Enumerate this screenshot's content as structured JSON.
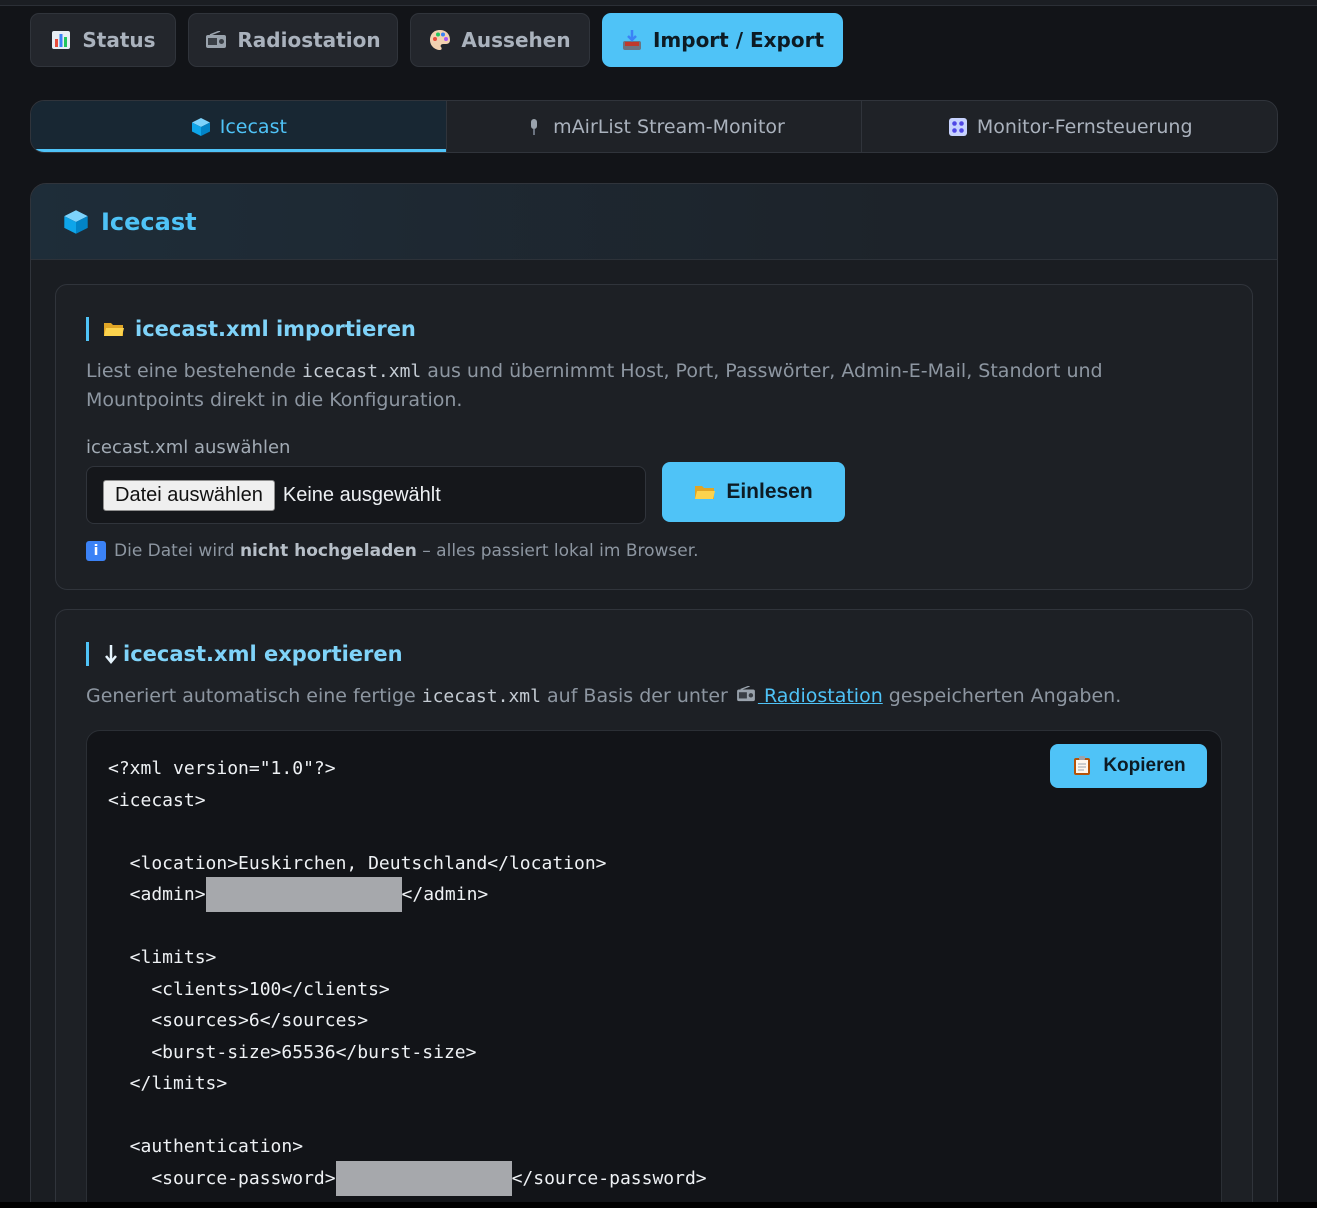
{
  "main_tabs": [
    {
      "label": "Status",
      "icon": "bar-chart-icon",
      "active": false
    },
    {
      "label": "Radiostation",
      "icon": "radio-icon",
      "active": false
    },
    {
      "label": "Aussehen",
      "icon": "palette-icon",
      "active": false
    },
    {
      "label": "Import / Export",
      "icon": "inbox-tray-icon",
      "active": true
    }
  ],
  "sub_tabs": [
    {
      "label": "Icecast",
      "icon": "cube-icon",
      "active": true
    },
    {
      "label": "mAirList Stream-Monitor",
      "icon": "microphone-icon",
      "active": false
    },
    {
      "label": "Monitor-Fernsteuerung",
      "icon": "control-knobs-icon",
      "active": false
    }
  ],
  "panel": {
    "title": "Icecast"
  },
  "import": {
    "title": "icecast.xml importieren",
    "desc_before": "Liest eine bestehende ",
    "desc_code": "icecast.xml",
    "desc_after": " aus und übernimmt Host, Port, Passwörter, Admin-E-Mail, Standort und Mountpoints direkt in die Konfiguration.",
    "field_label": "icecast.xml auswählen",
    "file_button": "Datei auswählen",
    "file_status": "Keine ausgewählt",
    "submit": "Einlesen",
    "hint_before": "Die Datei wird ",
    "hint_bold": "nicht hochgeladen",
    "hint_after": " – alles passiert lokal im Browser."
  },
  "export": {
    "title": "icecast.xml exportieren",
    "desc_before": "Generiert automatisch eine fertige ",
    "desc_code": "icecast.xml",
    "desc_mid": " auf Basis der unter ",
    "desc_link": "Radiostation",
    "desc_after": " gespeicherten Angaben.",
    "copy": "Kopieren",
    "code": {
      "l1": "<?xml version=\"1.0\"?>",
      "l2": "<icecast>",
      "l3": "  <location>Euskirchen, Deutschland</location>",
      "l4a": "  <admin>",
      "l4b": "</admin>",
      "l5": "  <limits>",
      "l6": "    <clients>100</clients>",
      "l7": "    <sources>6</sources>",
      "l8": "    <burst-size>65536</burst-size>",
      "l9": "  </limits>",
      "l10": "  <authentication>",
      "l11a": "    <source-password>",
      "l11b": "</source-password>"
    }
  },
  "colors": {
    "accent": "#4fc3f7",
    "background": "#121418",
    "panel": "#1a1d22"
  }
}
